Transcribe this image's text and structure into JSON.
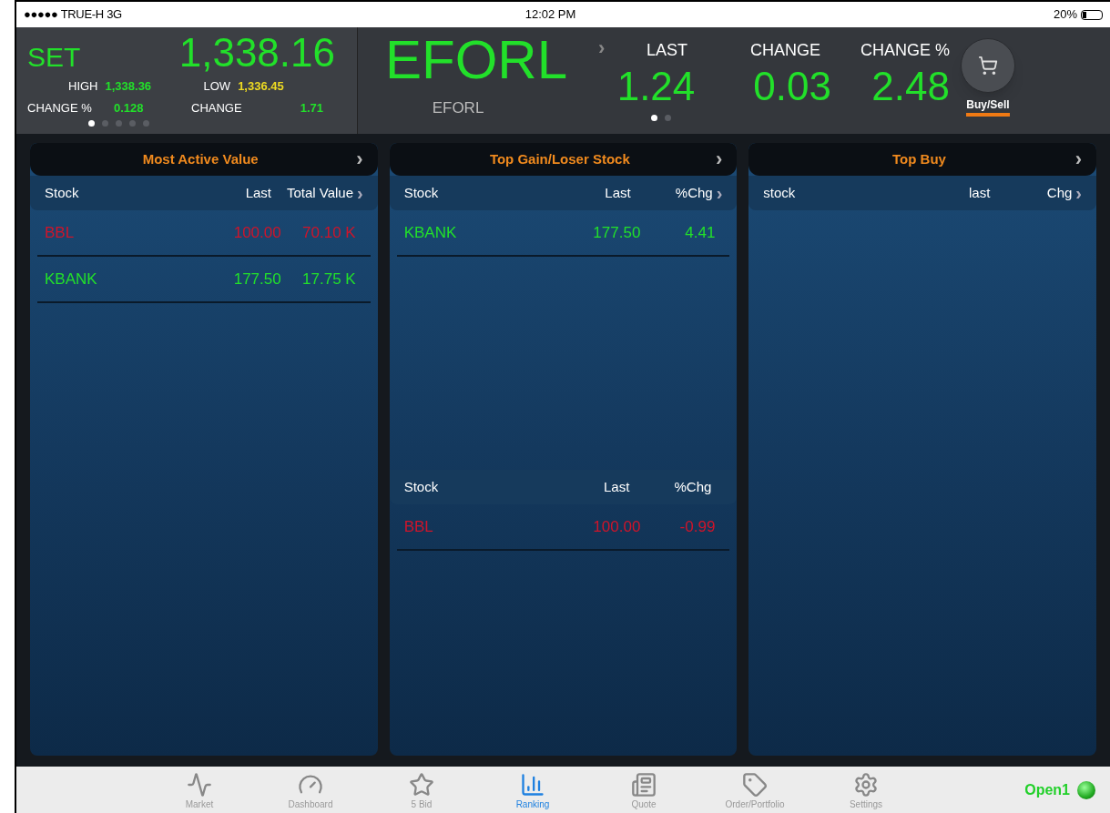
{
  "status_bar": {
    "carrier": "●●●●● TRUE-H  3G",
    "time": "12:02 PM",
    "battery": "20%"
  },
  "index": {
    "name": "SET",
    "value": "1,338.16",
    "high_label": "HIGH",
    "high": "1,338.36",
    "low_label": "LOW",
    "low": "1,336.45",
    "change_pct_label": "CHANGE %",
    "change_pct": "0.128",
    "change_label": "CHANGE",
    "change": "1.71",
    "dots": [
      {
        "selected": true
      },
      {
        "selected": false
      },
      {
        "selected": false
      },
      {
        "selected": false
      },
      {
        "selected": false
      }
    ]
  },
  "quote": {
    "symbol": "EFORL",
    "name": "EFORL",
    "arrow": "›",
    "last_label": "LAST",
    "last": "1.24",
    "change_label": "CHANGE",
    "change": "0.03",
    "change_pct_label": "CHANGE %",
    "change_pct": "2.48",
    "dots": [
      {
        "selected": true
      },
      {
        "selected": false
      }
    ]
  },
  "buy_sell": {
    "label": "Buy/Sell"
  },
  "panels": [
    {
      "title": "Most Active Value",
      "arrow": "›",
      "tables": [
        {
          "columns": [
            "Stock",
            "Last",
            "Total Value"
          ],
          "header_arrow": "›",
          "rows": [
            {
              "kind": "loss",
              "cells": [
                "BBL",
                "100.00",
                "70.10 K"
              ]
            },
            {
              "kind": "gain",
              "cells": [
                "KBANK",
                "177.50",
                "17.75 K"
              ]
            }
          ]
        }
      ]
    },
    {
      "title": "Top Gain/Loser Stock",
      "arrow": "›",
      "tables": [
        {
          "columns": [
            "Stock",
            "Last",
            "%Chg"
          ],
          "header_arrow": "›",
          "rows": [
            {
              "kind": "gain",
              "cells": [
                "KBANK",
                "177.50",
                "4.41"
              ]
            }
          ]
        },
        {
          "columns": [
            "Stock",
            "Last",
            "%Chg"
          ],
          "rows": [
            {
              "kind": "loss",
              "cells": [
                "BBL",
                "100.00",
                "-0.99"
              ]
            }
          ]
        }
      ]
    },
    {
      "title": "Top Buy",
      "arrow": "›",
      "tables": [
        {
          "columns": [
            "stock",
            "last",
            "Chg"
          ],
          "header_arrow": "›"
        }
      ]
    }
  ],
  "tab_bar": {
    "tabs": [
      {
        "kind": "market",
        "label": "Market",
        "selected": false
      },
      {
        "kind": "dashboard",
        "label": "Dashboard",
        "selected": false
      },
      {
        "kind": "bid",
        "label": "5 Bid",
        "selected": false
      },
      {
        "kind": "ranking",
        "label": "Ranking",
        "selected": true
      },
      {
        "kind": "quote",
        "label": "Quote",
        "selected": false
      },
      {
        "kind": "order",
        "label": "Order/Portfolio",
        "selected": false
      },
      {
        "kind": "settings",
        "label": "Settings",
        "selected": false
      }
    ],
    "connection": {
      "label": "Open1",
      "on": true
    }
  }
}
